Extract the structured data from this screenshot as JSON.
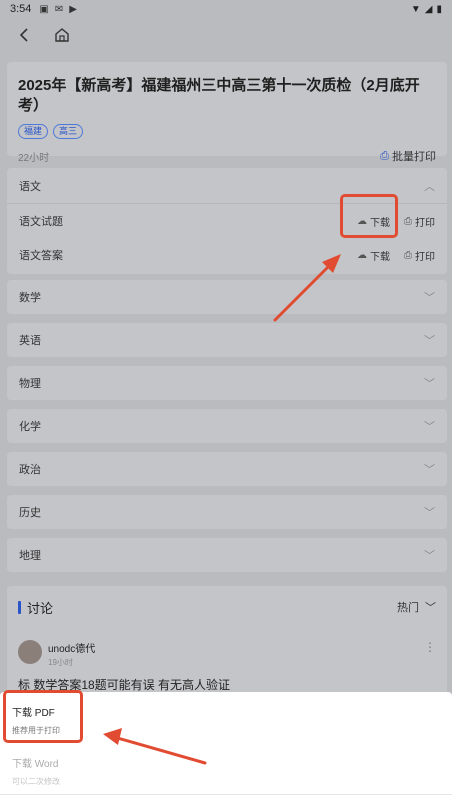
{
  "status_bar": {
    "time": "3:54",
    "left_icons": [
      "message-icon",
      "mail-icon",
      "play-icon"
    ],
    "right_icons": [
      "wifi-icon",
      "signal-icon",
      "battery-icon"
    ]
  },
  "nav": {
    "back_icon": "chevron-left-icon",
    "home_icon": "home-icon"
  },
  "header": {
    "title": "2025年【新高考】福建福州三中高三第十一次质检（2月底开考）",
    "tags": [
      "福建",
      "高三"
    ],
    "time_ago": "22小时",
    "batch_print_label": "批量打印"
  },
  "subjects": {
    "yuwen": {
      "label": "语文",
      "files": [
        {
          "name": "语文试题",
          "download_label": "下载",
          "print_label": "打印"
        },
        {
          "name": "语文答案",
          "download_label": "下载",
          "print_label": "打印"
        }
      ]
    },
    "others": [
      "数学",
      "英语",
      "物理",
      "化学",
      "政治",
      "历史",
      "地理"
    ]
  },
  "discussion": {
    "title": "讨论",
    "sort_label": "热门",
    "comment": {
      "user": "unodc德代",
      "time": "19小时",
      "text": "标 数学答案18题可能有误 有无高人验证"
    }
  },
  "sheet": {
    "pdf_title": "下载 PDF",
    "pdf_subtitle": "推荐用于打印",
    "word_title": "下载 Word",
    "word_subtitle": "可以二次修改"
  },
  "colors": {
    "accent": "#2a55c9",
    "annotation": "#e14b32",
    "overlay": "#b9bbbf"
  }
}
